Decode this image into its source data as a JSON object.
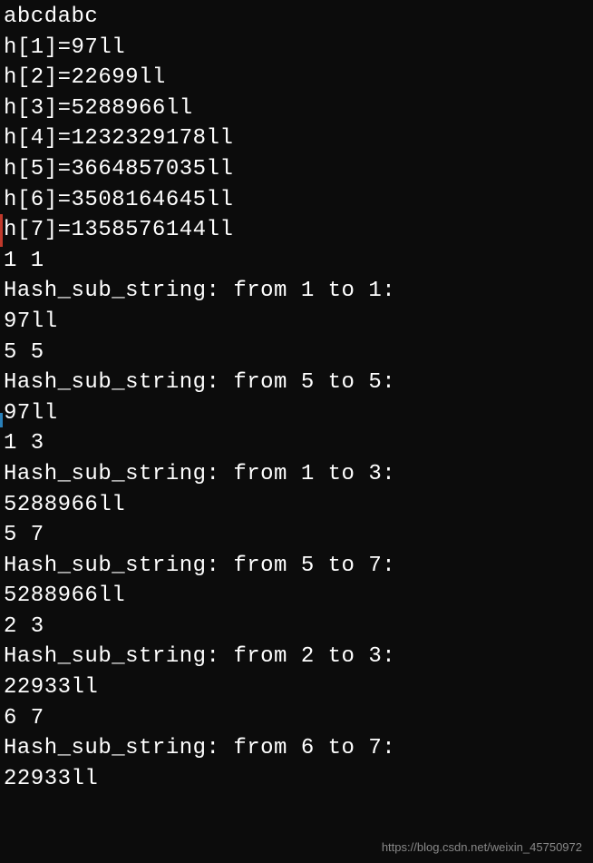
{
  "lines": {
    "l0": "abcdabc",
    "l1": "h[1]=97ll",
    "l2": "h[2]=22699ll",
    "l3": "h[3]=5288966ll",
    "l4": "h[4]=1232329178ll",
    "l5": "h[5]=3664857035ll",
    "l6": "h[6]=3508164645ll",
    "l7": "h[7]=1358576144ll",
    "l8": "1 1",
    "l9": "Hash_sub_string: from 1 to 1:",
    "l10": "97ll",
    "l11": "5 5",
    "l12": "Hash_sub_string: from 5 to 5:",
    "l13": "97ll",
    "l14": "1 3",
    "l15": "Hash_sub_string: from 1 to 3:",
    "l16": "5288966ll",
    "l17": "5 7",
    "l18": "Hash_sub_string: from 5 to 7:",
    "l19": "5288966ll",
    "l20": "2 3",
    "l21": "Hash_sub_string: from 2 to 3:",
    "l22": "22933ll",
    "l23": "6 7",
    "l24": "Hash_sub_string: from 6 to 7:",
    "l25": "22933ll"
  },
  "watermark": "https://blog.csdn.net/weixin_45750972"
}
